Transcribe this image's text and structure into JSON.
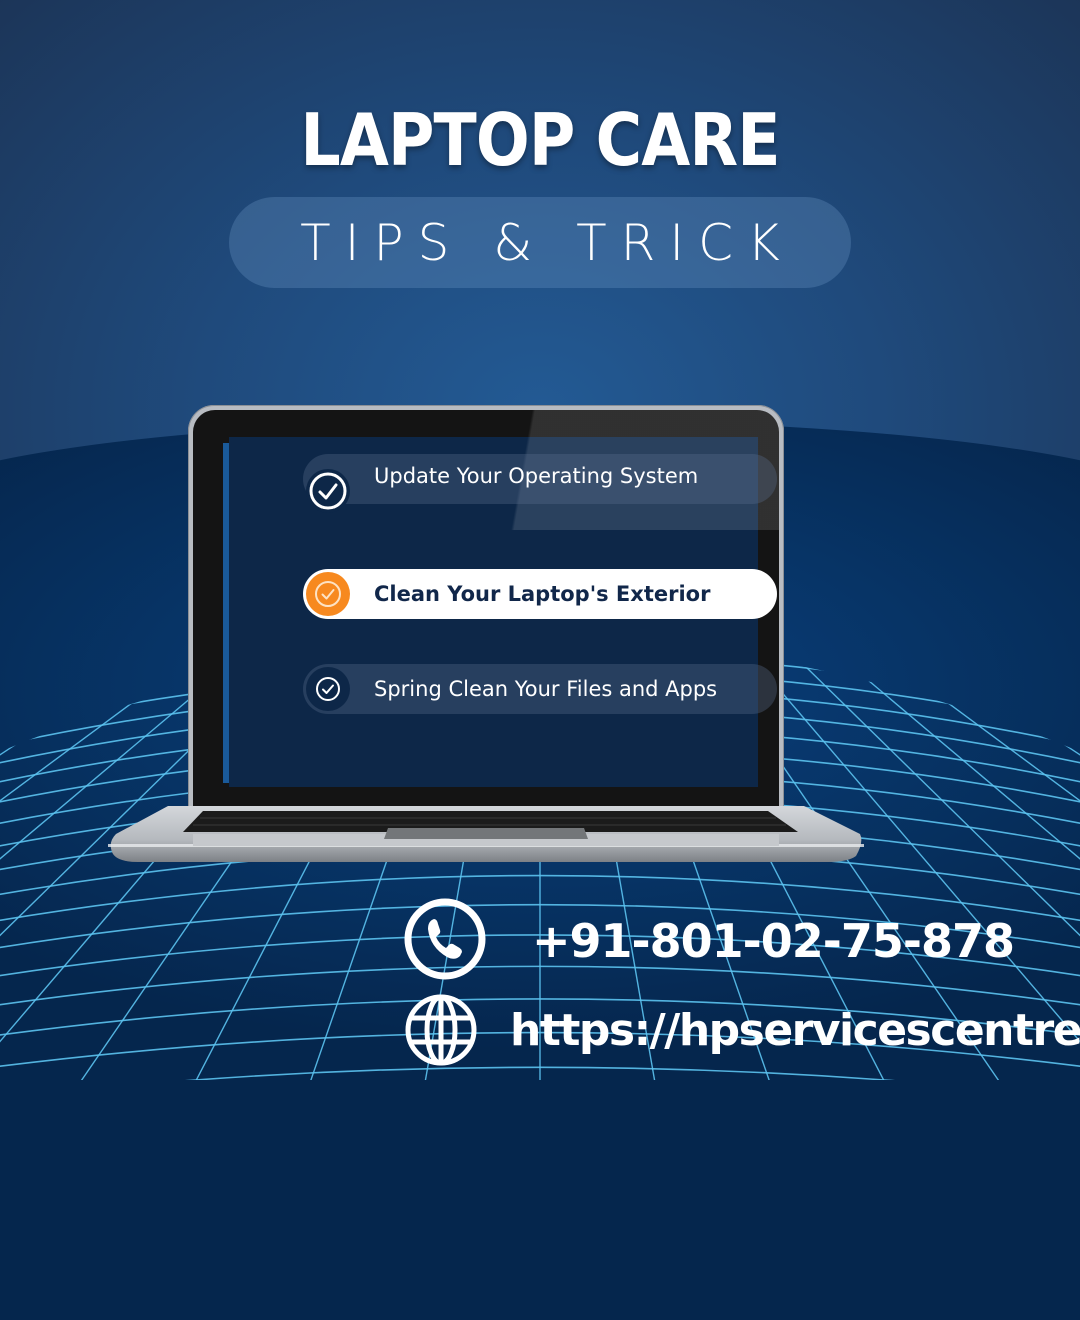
{
  "header": {
    "title": "LAPTOP CARE",
    "subtitle": "TIPS & TRICK"
  },
  "laptop_screen": {
    "items": [
      {
        "label": "Update Your Operating System",
        "icon": "check-circle-icon",
        "state": "completed"
      },
      {
        "label": "Clean Your Laptop's Exterior",
        "icon": "check-circle-icon",
        "state": "highlighted"
      },
      {
        "label": "Spring Clean Your Files and Apps",
        "icon": "check-circle-icon",
        "state": "completed"
      }
    ]
  },
  "contact": {
    "phone": "+91-801-02-75-878",
    "phone_icon": "phone-icon",
    "website": "https://hpservicescentre.in/",
    "website_icon": "globe-icon"
  },
  "colors": {
    "background": "#1f4a7c",
    "grid_line": "#5cc3f0",
    "accent_orange": "#f7891f",
    "screen": "#0d2748",
    "highlight_text": "#11274a"
  }
}
